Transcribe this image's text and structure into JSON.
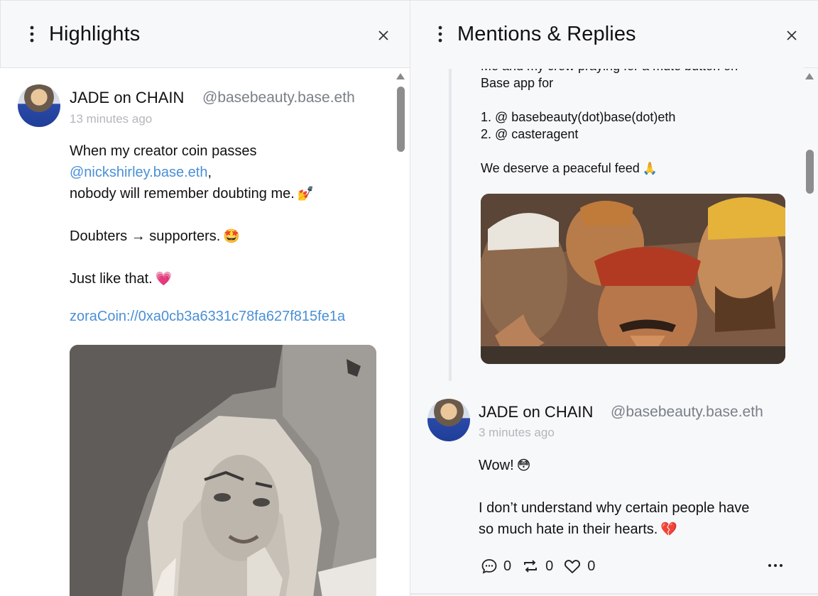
{
  "left_column": {
    "title": "Highlights",
    "post": {
      "author_name": "JADE on CHAIN",
      "author_handle": "@basebeauty.base.eth",
      "timestamp": "13 minutes ago",
      "lines": [
        {
          "text": "When my creator coin passes"
        },
        {
          "link": "@nickshirley.base.eth",
          "after": ","
        },
        {
          "text": "nobody will remember doubting me.",
          "emoji": "💅"
        },
        {
          "text": "Doubters → supporters.",
          "emoji": "🤩"
        },
        {
          "text": "Just like that.",
          "emoji": "💗"
        },
        {
          "link": "zoraCoin://0xa0cb3a6331c78fa627f815fe1a"
        }
      ]
    }
  },
  "right_column": {
    "title": "Mentions & Replies",
    "quoted": {
      "lines": [
        "Me and my crew praying for a mute button on",
        "Base app for",
        "1. @ basebeauty(dot)base(dot)eth",
        "2. @ casteragent",
        "We deserve a peaceful feed"
      ],
      "emoji": "🙏"
    },
    "reply": {
      "author_name": "JADE on CHAIN",
      "author_handle": "@basebeauty.base.eth",
      "timestamp": "3 minutes ago",
      "line1": "Wow!",
      "line1_emoji": "😳",
      "line2": "I don’t understand why certain people have",
      "line3": "so much hate in their hearts.",
      "line3_emoji": "💔",
      "replies_count": "0",
      "recasts_count": "0",
      "likes_count": "0"
    }
  },
  "colors": {
    "header_bg": "#f7f8fa",
    "link": "#4a8fd6",
    "muted": "#7a7f87",
    "timestamp": "#b3b6bb"
  }
}
